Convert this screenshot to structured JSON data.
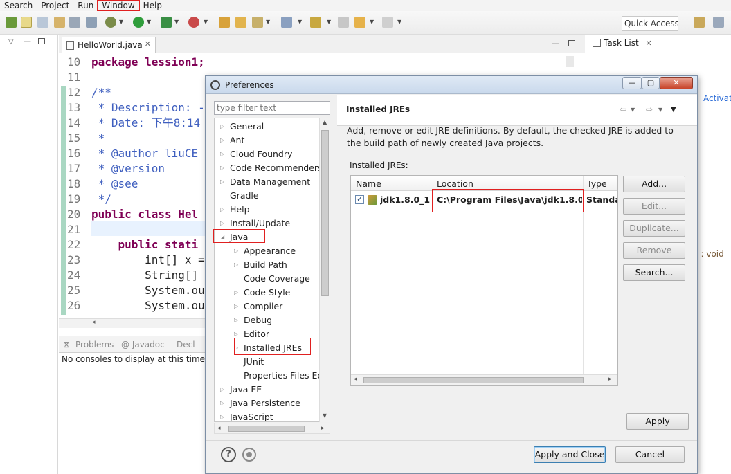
{
  "menubar": {
    "items": [
      "Search",
      "Project",
      "Run",
      "Window",
      "Help"
    ]
  },
  "toolbar": {
    "quick_access": "Quick Access"
  },
  "editor": {
    "tab_label": "HelloWorld.java",
    "lines": [
      {
        "n": "10",
        "text": "package lession1;"
      },
      {
        "n": "11",
        "text": ""
      },
      {
        "n": "12",
        "text": "/**"
      },
      {
        "n": "13",
        "text": " * Description: -"
      },
      {
        "n": "14",
        "text": " * Date: 下午8:14"
      },
      {
        "n": "15",
        "text": " *"
      },
      {
        "n": "16",
        "text": " * @author liuCE"
      },
      {
        "n": "17",
        "text": " * @version"
      },
      {
        "n": "18",
        "text": " * @see"
      },
      {
        "n": "19",
        "text": " */"
      },
      {
        "n": "20",
        "text": "public class Hel"
      },
      {
        "n": "21",
        "text": ""
      },
      {
        "n": "22",
        "text": "    public stati"
      },
      {
        "n": "23",
        "text": "        int[] x ="
      },
      {
        "n": "24",
        "text": "        String[]"
      },
      {
        "n": "25",
        "text": "        System.ou"
      },
      {
        "n": "26",
        "text": "        System.ou"
      }
    ]
  },
  "console": {
    "tabs": [
      "Problems",
      "@ Javadoc",
      "Decl"
    ],
    "message": "No consoles to display at this time."
  },
  "task_list": {
    "tab_label": "Task List",
    "activate_text": "Activate",
    "void_text": ") : void"
  },
  "preferences": {
    "title": "Preferences",
    "filter_placeholder": "type filter text",
    "tree": [
      {
        "label": "General",
        "level": 0,
        "twisty": "▷"
      },
      {
        "label": "Ant",
        "level": 0,
        "twisty": "▷"
      },
      {
        "label": "Cloud Foundry",
        "level": 0,
        "twisty": "▷"
      },
      {
        "label": "Code Recommenders",
        "level": 0,
        "twisty": "▷"
      },
      {
        "label": "Data Management",
        "level": 0,
        "twisty": "▷"
      },
      {
        "label": "Gradle",
        "level": 0,
        "twisty": ""
      },
      {
        "label": "Help",
        "level": 0,
        "twisty": "▷"
      },
      {
        "label": "Install/Update",
        "level": 0,
        "twisty": "▷"
      },
      {
        "label": "Java",
        "level": 0,
        "twisty": "◢"
      },
      {
        "label": "Appearance",
        "level": 1,
        "twisty": "▷"
      },
      {
        "label": "Build Path",
        "level": 1,
        "twisty": "▷"
      },
      {
        "label": "Code Coverage",
        "level": 1,
        "twisty": ""
      },
      {
        "label": "Code Style",
        "level": 1,
        "twisty": "▷"
      },
      {
        "label": "Compiler",
        "level": 1,
        "twisty": "▷"
      },
      {
        "label": "Debug",
        "level": 1,
        "twisty": "▷"
      },
      {
        "label": "Editor",
        "level": 1,
        "twisty": "▷"
      },
      {
        "label": "Installed JREs",
        "level": 1,
        "twisty": "▷"
      },
      {
        "label": "JUnit",
        "level": 1,
        "twisty": ""
      },
      {
        "label": "Properties Files Ed",
        "level": 1,
        "twisty": ""
      },
      {
        "label": "Java EE",
        "level": 0,
        "twisty": "▷"
      },
      {
        "label": "Java Persistence",
        "level": 0,
        "twisty": "▷"
      },
      {
        "label": "JavaScript",
        "level": 0,
        "twisty": "▷"
      }
    ],
    "page_title": "Installed JREs",
    "description": "Add, remove or edit JRE definitions. By default, the checked JRE is added to the build path of newly created Java projects.",
    "jres_label": "Installed JREs:",
    "table": {
      "columns": [
        "Name",
        "Location",
        "Type"
      ],
      "rows": [
        {
          "name": "jdk1.8.0_1...",
          "location": "C:\\Program Files\\Java\\jdk1.8.0_...",
          "type": "Standar"
        }
      ]
    },
    "buttons": {
      "add": "Add...",
      "edit": "Edit...",
      "duplicate": "Duplicate...",
      "remove": "Remove",
      "search": "Search...",
      "apply": "Apply",
      "apply_close": "Apply and Close",
      "cancel": "Cancel"
    }
  }
}
